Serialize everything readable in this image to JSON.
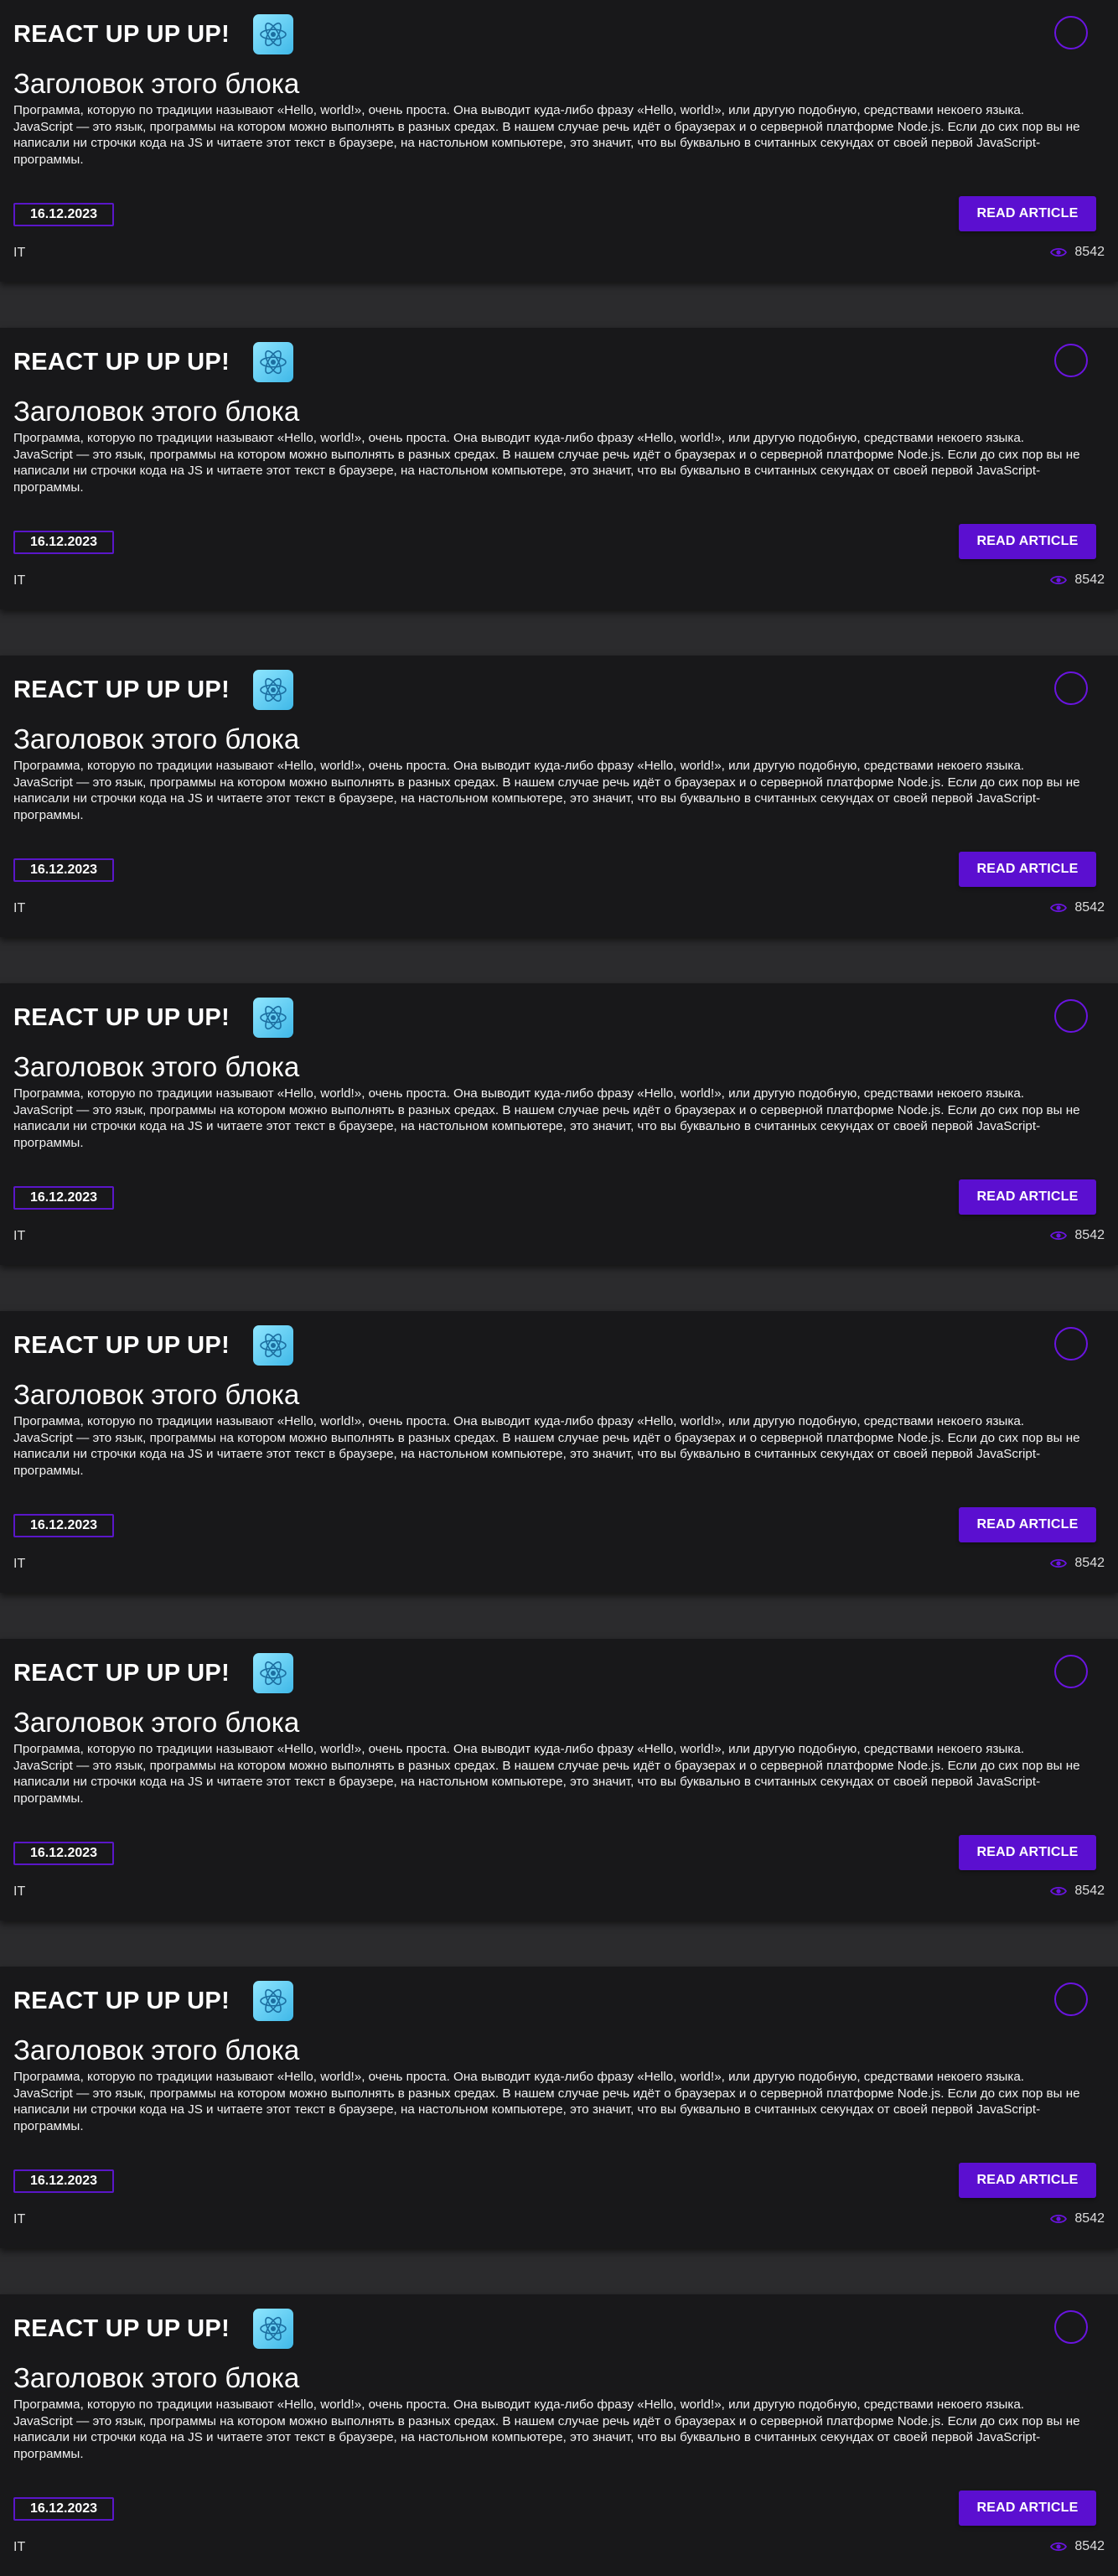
{
  "colors": {
    "accent": "#5b0fd0",
    "card_background": "#18181a",
    "page_background": "#2b2b2d",
    "text": "#ffffff"
  },
  "cards": [
    {
      "brand": "REACT UP UP UP!",
      "logo_icon": "react-atom-icon",
      "menu_icon": "circle-outline-icon",
      "title": "Заголовок этого блока",
      "paragraph_1": "Программа, которую по традиции называют «Hello, world!», очень проста. Она выводит куда-либо фразу «Hello, world!», или другую подобную, средствами некоего языка.",
      "paragraph_2": "JavaScript — это язык, программы на котором можно выполнять в разных средах. В нашем случае речь идёт о браузерах и о серверной платформе Node.js. Если до сих пор вы не написали ни строчки кода на JS и читаете этот текст в браузере, на настольном компьютере, это значит, что вы буквально в считанных секундах от своей первой JavaScript-программы.",
      "date": "16.12.2023",
      "read_label": "READ ARTICLE",
      "category": "IT",
      "views_icon": "eye-icon",
      "views": "8542"
    },
    {
      "brand": "REACT UP UP UP!",
      "logo_icon": "react-atom-icon",
      "menu_icon": "circle-outline-icon",
      "title": "Заголовок этого блока",
      "paragraph_1": "Программа, которую по традиции называют «Hello, world!», очень проста. Она выводит куда-либо фразу «Hello, world!», или другую подобную, средствами некоего языка.",
      "paragraph_2": "JavaScript — это язык, программы на котором можно выполнять в разных средах. В нашем случае речь идёт о браузерах и о серверной платформе Node.js. Если до сих пор вы не написали ни строчки кода на JS и читаете этот текст в браузере, на настольном компьютере, это значит, что вы буквально в считанных секундах от своей первой JavaScript-программы.",
      "date": "16.12.2023",
      "read_label": "READ ARTICLE",
      "category": "IT",
      "views_icon": "eye-icon",
      "views": "8542"
    },
    {
      "brand": "REACT UP UP UP!",
      "logo_icon": "react-atom-icon",
      "menu_icon": "circle-outline-icon",
      "title": "Заголовок этого блока",
      "paragraph_1": "Программа, которую по традиции называют «Hello, world!», очень проста. Она выводит куда-либо фразу «Hello, world!», или другую подобную, средствами некоего языка.",
      "paragraph_2": "JavaScript — это язык, программы на котором можно выполнять в разных средах. В нашем случае речь идёт о браузерах и о серверной платформе Node.js. Если до сих пор вы не написали ни строчки кода на JS и читаете этот текст в браузере, на настольном компьютере, это значит, что вы буквально в считанных секундах от своей первой JavaScript-программы.",
      "date": "16.12.2023",
      "read_label": "READ ARTICLE",
      "category": "IT",
      "views_icon": "eye-icon",
      "views": "8542"
    },
    {
      "brand": "REACT UP UP UP!",
      "logo_icon": "react-atom-icon",
      "menu_icon": "circle-outline-icon",
      "title": "Заголовок этого блока",
      "paragraph_1": "Программа, которую по традиции называют «Hello, world!», очень проста. Она выводит куда-либо фразу «Hello, world!», или другую подобную, средствами некоего языка.",
      "paragraph_2": "JavaScript — это язык, программы на котором можно выполнять в разных средах. В нашем случае речь идёт о браузерах и о серверной платформе Node.js. Если до сих пор вы не написали ни строчки кода на JS и читаете этот текст в браузере, на настольном компьютере, это значит, что вы буквально в считанных секундах от своей первой JavaScript-программы.",
      "date": "16.12.2023",
      "read_label": "READ ARTICLE",
      "category": "IT",
      "views_icon": "eye-icon",
      "views": "8542"
    },
    {
      "brand": "REACT UP UP UP!",
      "logo_icon": "react-atom-icon",
      "menu_icon": "circle-outline-icon",
      "title": "Заголовок этого блока",
      "paragraph_1": "Программа, которую по традиции называют «Hello, world!», очень проста. Она выводит куда-либо фразу «Hello, world!», или другую подобную, средствами некоего языка.",
      "paragraph_2": "JavaScript — это язык, программы на котором можно выполнять в разных средах. В нашем случае речь идёт о браузерах и о серверной платформе Node.js. Если до сих пор вы не написали ни строчки кода на JS и читаете этот текст в браузере, на настольном компьютере, это значит, что вы буквально в считанных секундах от своей первой JavaScript-программы.",
      "date": "16.12.2023",
      "read_label": "READ ARTICLE",
      "category": "IT",
      "views_icon": "eye-icon",
      "views": "8542"
    },
    {
      "brand": "REACT UP UP UP!",
      "logo_icon": "react-atom-icon",
      "menu_icon": "circle-outline-icon",
      "title": "Заголовок этого блока",
      "paragraph_1": "Программа, которую по традиции называют «Hello, world!», очень проста. Она выводит куда-либо фразу «Hello, world!», или другую подобную, средствами некоего языка.",
      "paragraph_2": "JavaScript — это язык, программы на котором можно выполнять в разных средах. В нашем случае речь идёт о браузерах и о серверной платформе Node.js. Если до сих пор вы не написали ни строчки кода на JS и читаете этот текст в браузере, на настольном компьютере, это значит, что вы буквально в считанных секундах от своей первой JavaScript-программы.",
      "date": "16.12.2023",
      "read_label": "READ ARTICLE",
      "category": "IT",
      "views_icon": "eye-icon",
      "views": "8542"
    },
    {
      "brand": "REACT UP UP UP!",
      "logo_icon": "react-atom-icon",
      "menu_icon": "circle-outline-icon",
      "title": "Заголовок этого блока",
      "paragraph_1": "Программа, которую по традиции называют «Hello, world!», очень проста. Она выводит куда-либо фразу «Hello, world!», или другую подобную, средствами некоего языка.",
      "paragraph_2": "JavaScript — это язык, программы на котором можно выполнять в разных средах. В нашем случае речь идёт о браузерах и о серверной платформе Node.js. Если до сих пор вы не написали ни строчки кода на JS и читаете этот текст в браузере, на настольном компьютере, это значит, что вы буквально в считанных секундах от своей первой JavaScript-программы.",
      "date": "16.12.2023",
      "read_label": "READ ARTICLE",
      "category": "IT",
      "views_icon": "eye-icon",
      "views": "8542"
    },
    {
      "brand": "REACT UP UP UP!",
      "logo_icon": "react-atom-icon",
      "menu_icon": "circle-outline-icon",
      "title": "Заголовок этого блока",
      "paragraph_1": "Программа, которую по традиции называют «Hello, world!», очень проста. Она выводит куда-либо фразу «Hello, world!», или другую подобную, средствами некоего языка.",
      "paragraph_2": "JavaScript — это язык, программы на котором можно выполнять в разных средах. В нашем случае речь идёт о браузерах и о серверной платформе Node.js. Если до сих пор вы не написали ни строчки кода на JS и читаете этот текст в браузере, на настольном компьютере, это значит, что вы буквально в считанных секундах от своей первой JavaScript-программы.",
      "date": "16.12.2023",
      "read_label": "READ ARTICLE",
      "category": "IT",
      "views_icon": "eye-icon",
      "views": "8542"
    }
  ]
}
